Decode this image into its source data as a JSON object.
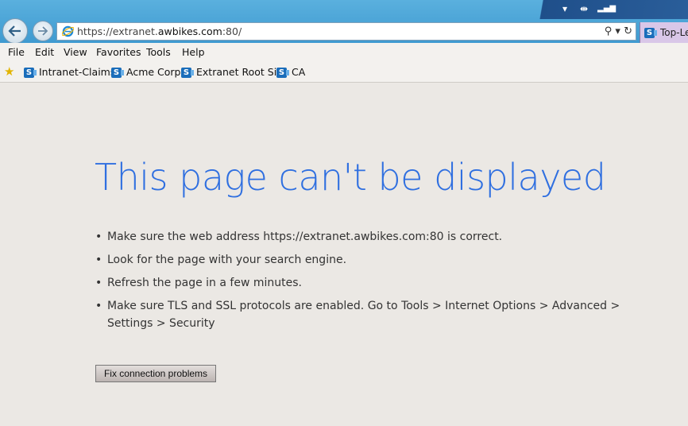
{
  "browser": {
    "address": {
      "prefix": "https://extranet.",
      "host_bold": "awbikes.com",
      "suffix": ":80/"
    },
    "address_tools": "⚲ ▾ ↻",
    "tab_label": "Top-Le",
    "window_controls": "▾ ⇥ ▮"
  },
  "menu": [
    {
      "label": "File"
    },
    {
      "label": "Edit"
    },
    {
      "label": "View"
    },
    {
      "label": "Favorites"
    },
    {
      "label": "Tools"
    },
    {
      "label": "Help"
    }
  ],
  "favorites": [
    {
      "label": "Intranet-Claims"
    },
    {
      "label": "Acme Corp"
    },
    {
      "label": "Extranet Root Site"
    },
    {
      "label": "CA"
    }
  ],
  "error": {
    "title": "This page can't be displayed",
    "tips": [
      "Make sure the web address https://extranet.awbikes.com:80 is correct.",
      "Look for the page with your search engine.",
      "Refresh the page in a few minutes.",
      "Make sure TLS and SSL protocols are enabled. Go to Tools > Internet Options > Advanced > Settings > Security"
    ],
    "button_label": "Fix connection problems"
  },
  "colors": {
    "title_blue": "#2f6fe0",
    "page_bg": "#ebe8e4",
    "titlebar_blue": "#4aa5d8"
  }
}
